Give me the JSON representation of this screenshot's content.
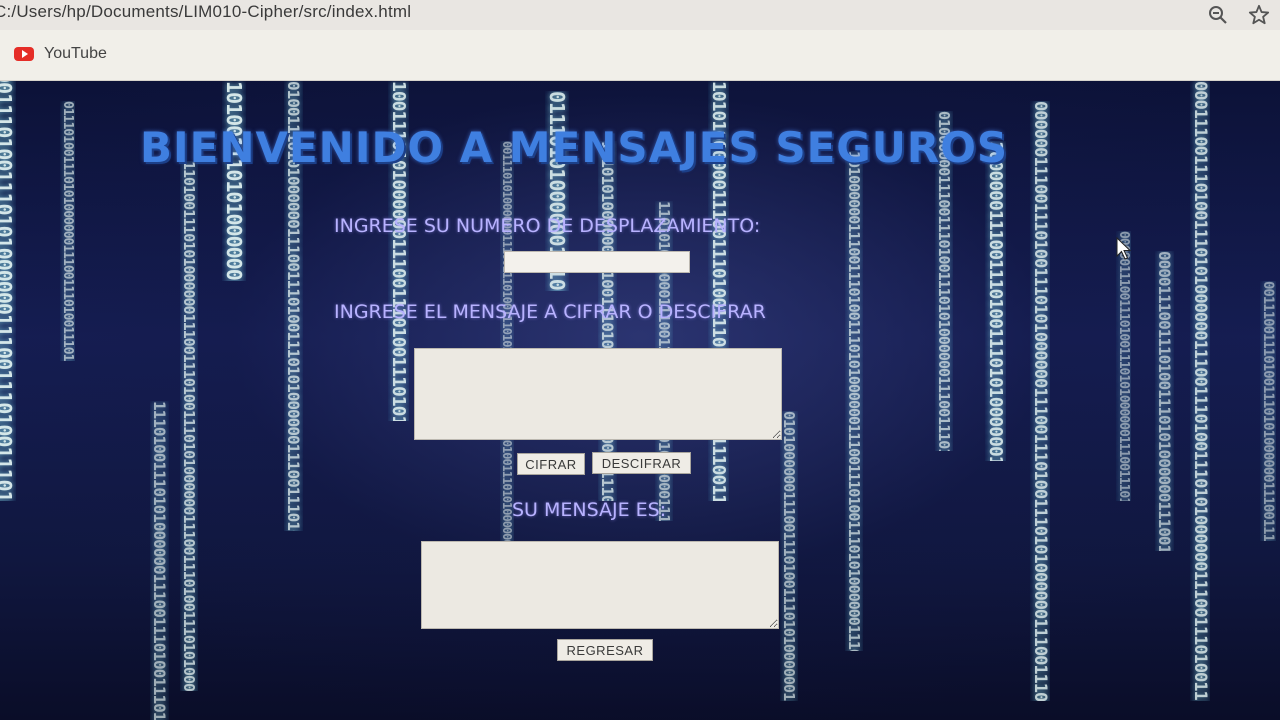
{
  "browser": {
    "url": "C:/Users/hp/Documents/LIM010-Cipher/src/index.html",
    "bookmarks": [
      {
        "label": "YouTube",
        "icon": "youtube-icon"
      }
    ],
    "icons": {
      "zoom": "zoom-out-icon",
      "bookmark_star": "star-icon"
    }
  },
  "page": {
    "title": "BIENVENIDO A MENSAJES SEGUROS",
    "shift_label": "INGRESE SU NUMERO DE DESPLAZAMIENTO:",
    "shift_value": "",
    "message_label": "INGRESE EL MENSAJE A CIFRAR O DESCIFRAR",
    "message_value": "",
    "buttons": {
      "cipher": "CIFRAR",
      "decipher": "DESCIFRAR",
      "back": "REGRESAR"
    },
    "result_label": "SU MENSAJE ES:",
    "result_value": ""
  },
  "background": {
    "binary_text": "0011101001110101000000111",
    "colors": {
      "title": "#3f7fe0",
      "labels": "#b8b2ff",
      "binary": "#dff2f2"
    }
  }
}
